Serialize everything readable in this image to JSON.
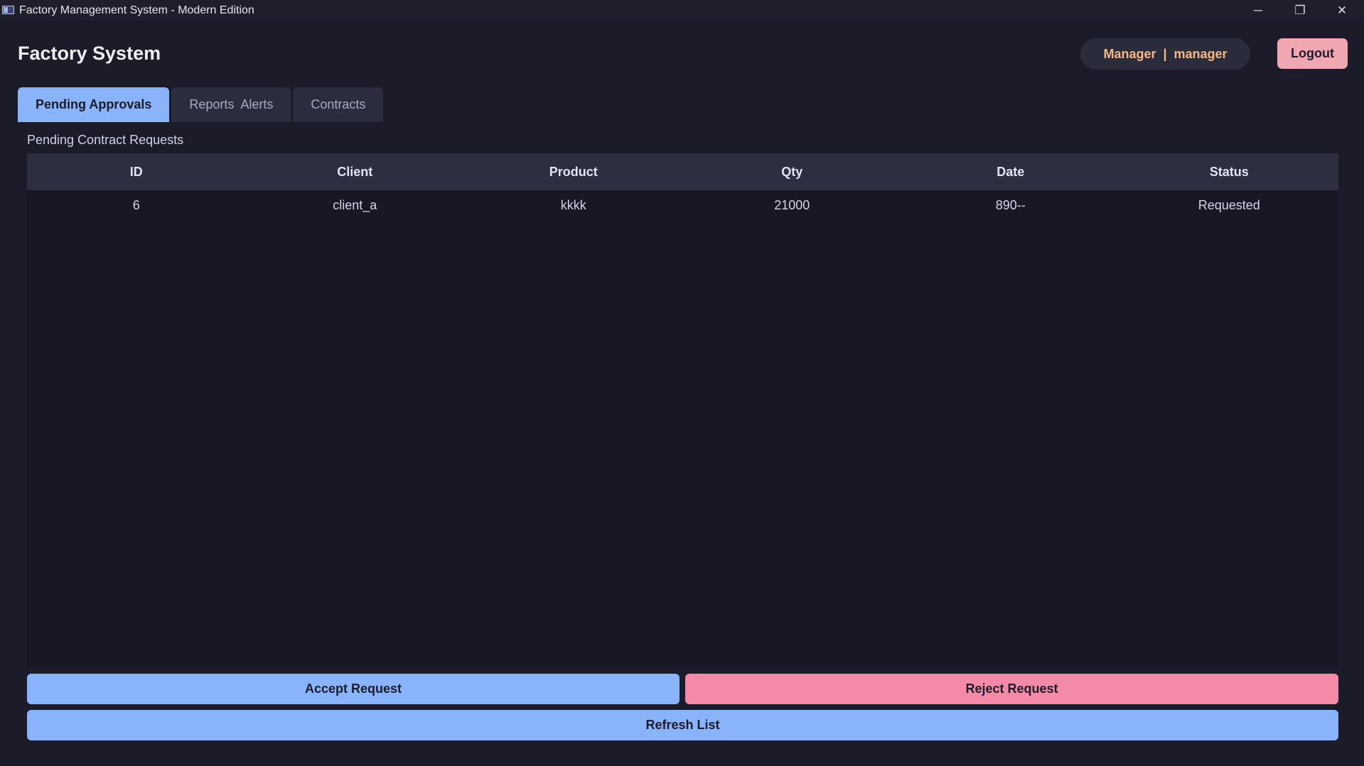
{
  "window": {
    "title": "Factory Management System - Modern Edition",
    "controls": {
      "minimize": "─",
      "maximize": "❐",
      "close": "✕"
    }
  },
  "header": {
    "app_title": "Factory System",
    "user_role": "Manager",
    "separator": "|",
    "user_name": "manager",
    "logout_label": "Logout"
  },
  "tabs": [
    {
      "label": "Pending Approvals",
      "active": true
    },
    {
      "label": "Reports  Alerts",
      "active": false
    },
    {
      "label": "Contracts",
      "active": false
    }
  ],
  "main": {
    "section_label": "Pending Contract Requests",
    "columns": [
      "ID",
      "Client",
      "Product",
      "Qty",
      "Date",
      "Status"
    ],
    "rows": [
      [
        "6",
        "client_a",
        "kkkk",
        "21000",
        "890--",
        "Requested"
      ]
    ]
  },
  "actions": {
    "accept_label": "Accept Request",
    "reject_label": "Reject Request",
    "refresh_label": "Refresh List"
  },
  "colors": {
    "accent_blue": "#89b4fa",
    "accent_pink": "#f38ba8",
    "user_text": "#f5b886",
    "background": "#1b1b29"
  }
}
